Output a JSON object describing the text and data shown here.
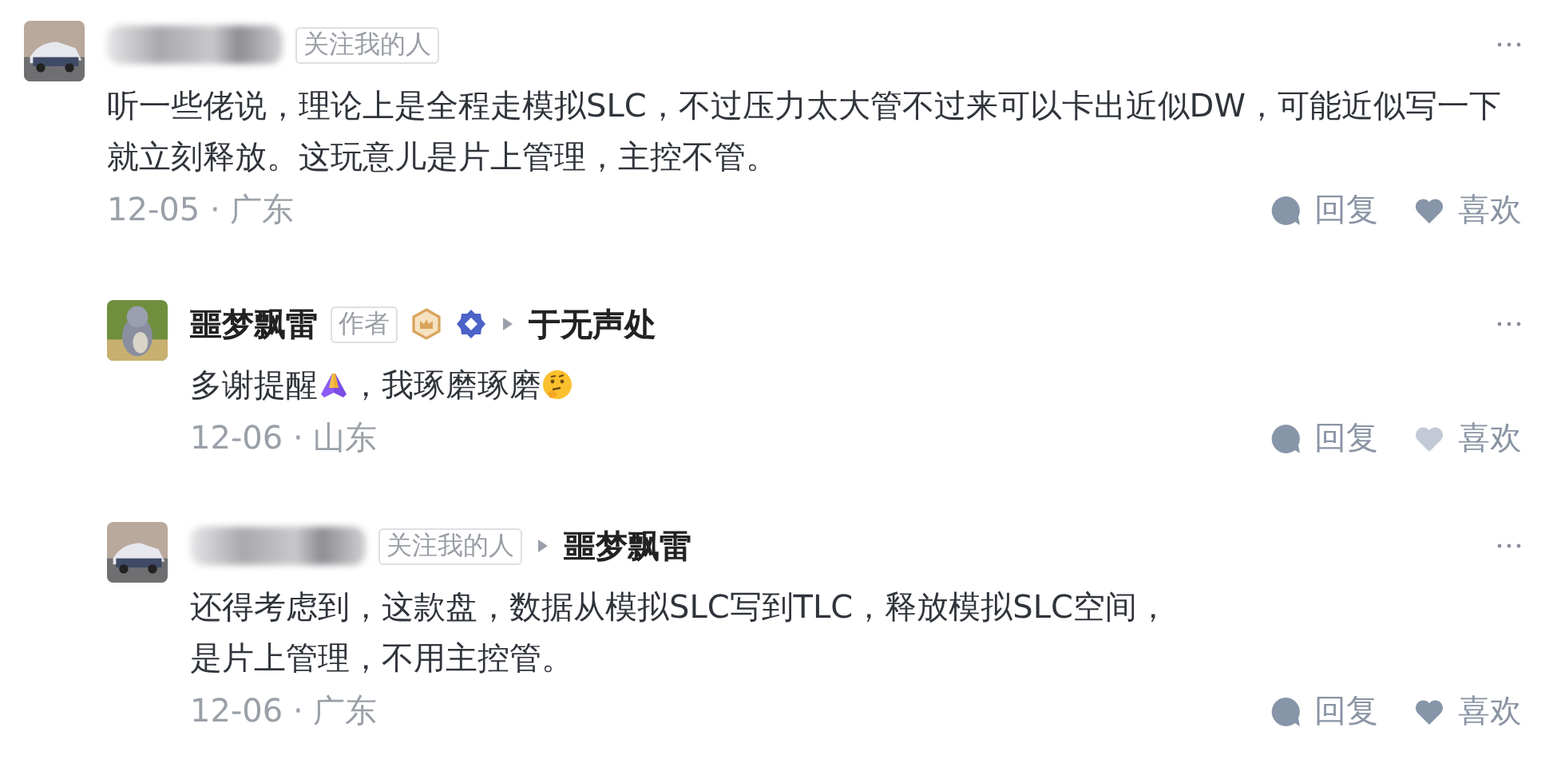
{
  "comments": [
    {
      "name_hidden": true,
      "tag": "关注我的人",
      "badges": false,
      "text": [
        {
          "kind": "text",
          "text": "听一些佬说，理论上是全程走模拟SLC，不过压力太大管不过来可以卡出近似DW，可能近似写一下就立刻释放。这玩意儿是片上管理，主控不管。"
        }
      ],
      "date": "12-05",
      "separator": "·",
      "location": "广东",
      "reply_label": "回复",
      "like_label": "喜欢",
      "liked": true,
      "replies": [
        {
          "name": "噩梦飘雷",
          "name_hidden": false,
          "tag": "作者",
          "badges": true,
          "reply_to": "于无声处",
          "text": [
            {
              "kind": "text",
              "text": "多谢提醒"
            },
            {
              "kind": "hands-emoji"
            },
            {
              "kind": "text",
              "text": "，我琢磨琢磨"
            },
            {
              "kind": "face-emoji"
            }
          ],
          "date": "12-06",
          "separator": "·",
          "location": "山东",
          "reply_label": "回复",
          "like_label": "喜欢",
          "liked": false
        },
        {
          "name_hidden": true,
          "tag": "关注我的人",
          "badges": false,
          "reply_to": "噩梦飘雷",
          "text": [
            {
              "kind": "text",
              "text": "还得考虑到，这款盘，数据从模拟SLC写到TLC，释放模拟SLC空间，是片上管理，不用主控管。"
            }
          ],
          "date": "12-06",
          "separator": "·",
          "location": "广东",
          "reply_label": "回复",
          "like_label": "喜欢",
          "liked": true
        }
      ]
    }
  ]
}
